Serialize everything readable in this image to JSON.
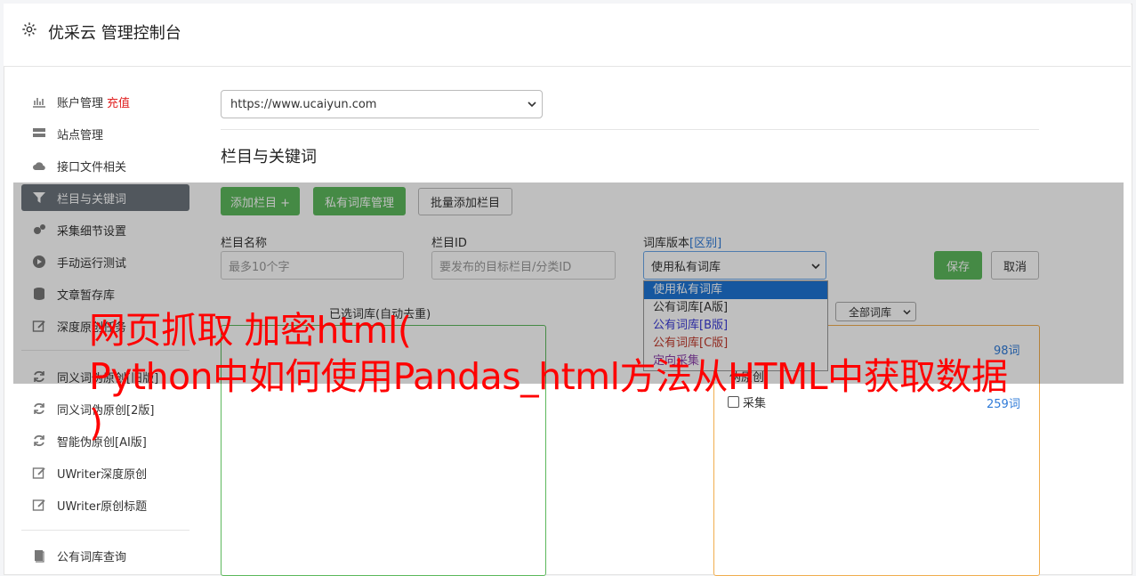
{
  "header": {
    "title": "优采云 管理控制台"
  },
  "sidebar": {
    "items": [
      {
        "label": "账户管理",
        "extra": "充值"
      },
      {
        "label": "站点管理"
      },
      {
        "label": "接口文件相关"
      },
      {
        "label": "栏目与关键词"
      },
      {
        "label": "采集细节设置"
      },
      {
        "label": "手动运行测试"
      },
      {
        "label": "文章暂存库"
      },
      {
        "label": "深度原创任务"
      },
      {
        "label": "同义词伪原创[旧版]"
      },
      {
        "label": "同义词伪原创[2版]"
      },
      {
        "label": "智能伪原创[AI版]"
      },
      {
        "label": "UWriter深度原创"
      },
      {
        "label": "UWriter原创标题"
      },
      {
        "label": "公有词库查询"
      }
    ]
  },
  "main": {
    "site_select": "https://www.ucaiyun.com",
    "section_title": "栏目与关键词",
    "buttons": {
      "add_column": "添加栏目 +",
      "private_lib": "私有词库管理",
      "batch_add": "批量添加栏目",
      "save": "保存",
      "cancel": "取消"
    },
    "fields": {
      "column_name_label": "栏目名称",
      "column_name_placeholder": "最多10个字",
      "column_id_label": "栏目ID",
      "column_id_placeholder": "要发布的目标栏目/分类ID",
      "lib_version_label": "词库版本",
      "lib_version_link": "[区别]",
      "lib_version_value": "使用私有词库"
    },
    "dropdown_options": [
      "使用私有词库",
      "公有词库[A版]",
      "公有词库[B版]",
      "公有词库[C版]",
      "定向采集"
    ],
    "selected_lib_label": "已选词库(自动去重)",
    "filter_select": "全部词库",
    "right_list": [
      {
        "label": "",
        "count": "98词"
      },
      {
        "label": "伪原创",
        "count": ""
      },
      {
        "label": "采集",
        "count": "259词"
      }
    ]
  },
  "watermark": "网页抓取 加密html(\nPython中如何使用Pandas_html方法从HTML中获取数据\n)",
  "colors": {
    "green": "#5cb85c",
    "orange": "#f0ad4e",
    "red": "#ff0000",
    "link": "#2f7bd8"
  }
}
